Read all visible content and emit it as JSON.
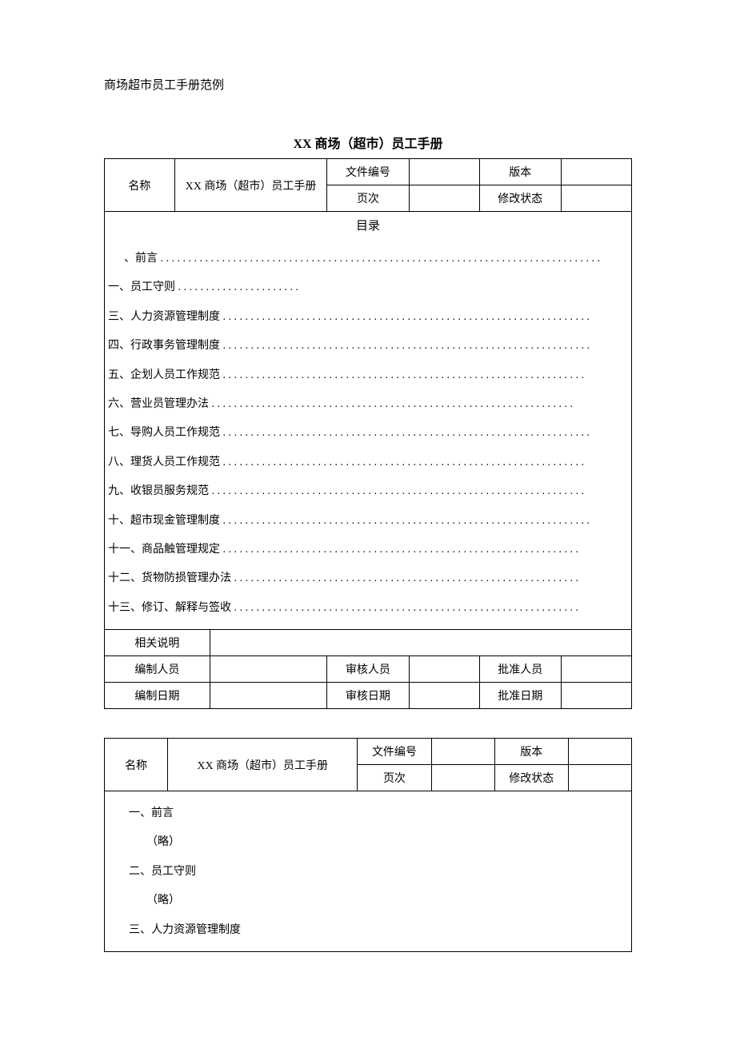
{
  "subtitle": "商场超市员工手册范例",
  "title": "XX 商场（超市）员工手册",
  "header": {
    "name_label": "名称",
    "name_value": "XX 商场（超市）员工手册",
    "docno_label": "文件编号",
    "docno_value": "",
    "version_label": "版本",
    "version_value": "",
    "page_label": "页次",
    "page_value": "",
    "revstatus_label": "修改状态",
    "revstatus_value": ""
  },
  "toc_header": "目录",
  "toc": {
    "items": [
      {
        "text": "、前言 . . . . . . . . . . . . . . . . . . . . . . . . . . . . . . . . . . . . . . . . . . . . . . . . . . . . . . . . . . . . . . . . . . . . . . . . . . . . . . .",
        "indent": true
      },
      {
        "text": "一、员工守则 . . . . . . . . . . . . . . . . . . . . . .",
        "indent": false
      },
      {
        "text": "三、人力资源管理制度  . . . . . . . . . . . . . . . . . . . . . . . . . . . . . . . . . . . . . . . . . . . . . . . . . . . . . . . . . . . . . . . . . .",
        "indent": false
      },
      {
        "text": "四、行政事务管理制度  . . . . . . . . . . . . . . . . . . . . . . . . . . . . . . . . . . . . . . . . . . . . . . . . . . . . . . . . . . . . . . . . . .",
        "indent": false
      },
      {
        "text": "五、企划人员工作规范  . . . . . . . . . . . . . . . . . . . . . . . . . . . . . . . . . . . . . . . . . . . . . . . . . . . . . . . . . . . . . . . . .",
        "indent": false
      },
      {
        "text": "六、营业员管理办法  . . . . . . . . . . . . . . . . . . . . . . . . . . . . . . . . . . . . . . . . . . . . . . . . . . . . . . . . . . . . . . . . .",
        "indent": false
      },
      {
        "text": "七、导购人员工作规范  . . . . . . . . . . . . . . . . . . . . . . . . . . . . . . . . . . . . . . . . . . . . . . . . . . . . . . . . . . . . . . . . . .",
        "indent": false
      },
      {
        "text": "八、理货人员工作规范  . . . . . . . . . . . . . . . . . . . . . . . . . . . . . . . . . . . . . . . . . . . . . . . . . . . . . . . . . . . . . . . . .",
        "indent": false
      },
      {
        "text": "九、收银员服务规范  . . . . . . . . . . . . . . . . . . . . . . . . . . . . . . . . . . . . . . . . . . . . . . . . . . . . . . . . . . . . . . . . . . .",
        "indent": false
      },
      {
        "text": "十、超市现金管理制度  . . . . . . . . . . . . . . . . . . . . . . . . . . . . . . . . . . . . . . . . . . . . . . . . . . . . . . . . . . . . . . . . . .",
        "indent": false
      },
      {
        "text": "十一、商品触管理规定  . . . . . . . . . . . . . . . . . . . . . . . . . . . . . . . . . . . . . . . . . . . . . . . . . . . . . . . . . . . . . . . .",
        "indent": false
      },
      {
        "text": "十二、货物防损管理办法  . . . . . . . . . . . . . . . . . . . . . . . . . . . . . . . . . . . . . . . . . . . . . . . . . . . . . . . . . . . . . .",
        "indent": false
      },
      {
        "text": "十三、修订、解释与签收  . . . . . . . . . . . . . . . . . . . . . . . . . . . . . . . . . . . . . . . . . . . . . . . . . . . . . . . . . . . . . .",
        "indent": false
      }
    ]
  },
  "footer": {
    "relnote_label": "相关说明",
    "relnote_value": "",
    "author_label": "编制人员",
    "author_value": "",
    "reviewer_label": "审核人员",
    "reviewer_value": "",
    "approver_label": "批准人员",
    "approver_value": "",
    "author_date_label": "编制日期",
    "author_date_value": "",
    "review_date_label": "审核日期",
    "review_date_value": "",
    "approve_date_label": "批准日期",
    "approve_date_value": ""
  },
  "content": {
    "lines": [
      {
        "text": "一、前言",
        "indent": false
      },
      {
        "text": "（略）",
        "indent": true
      },
      {
        "text": "二、员工守则",
        "indent": false
      },
      {
        "text": "（略）",
        "indent": true
      },
      {
        "text": "三、人力资源管理制度",
        "indent": false
      }
    ]
  }
}
